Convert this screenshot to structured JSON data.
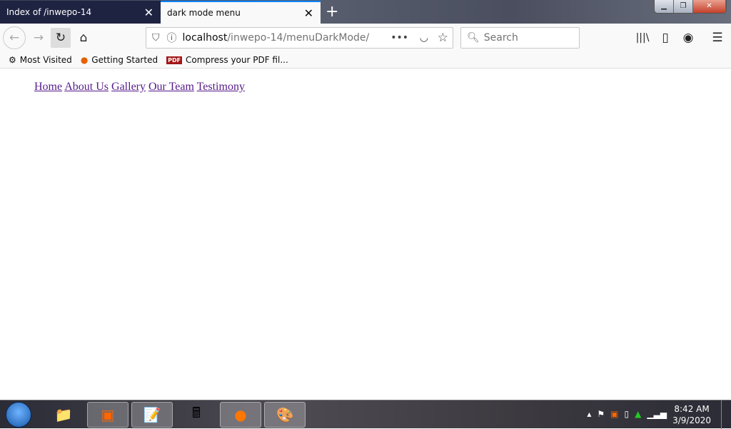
{
  "browser": {
    "tabs": [
      {
        "title": "Index of /inwepo-14",
        "active": false
      },
      {
        "title": "dark mode menu",
        "active": true
      }
    ],
    "url_host": "localhost",
    "url_path": "/inwepo-14/menuDarkMode/",
    "search_placeholder": "Search",
    "bookmarks": [
      "Most Visited",
      "Getting Started",
      "Compress your PDF fil..."
    ],
    "pdf_badge": "PDF"
  },
  "page": {
    "menu": [
      "Home",
      "About Us",
      "Gallery",
      "Our Team",
      "Testimony"
    ]
  },
  "taskbar": {
    "time": "8:42 AM",
    "date": "3/9/2020"
  }
}
